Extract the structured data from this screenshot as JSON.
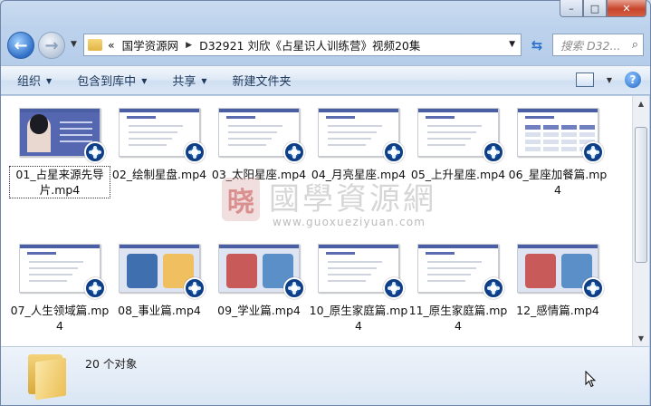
{
  "window": {
    "caption_buttons": [
      "–",
      "□",
      "✕"
    ]
  },
  "nav": {
    "breadcrumb_root": "«",
    "breadcrumbs": [
      "国学资源网",
      "D32921  刘欣《占星识人训练营》视频20集"
    ],
    "search_placeholder": "搜索 D32..."
  },
  "toolbar": {
    "items": [
      "组织",
      "包含到库中",
      "共享",
      "新建文件夹"
    ],
    "help_label": "?"
  },
  "files": [
    {
      "name": "01_占星来源先导片.mp4",
      "thumb": "portrait",
      "selected": true
    },
    {
      "name": "02_绘制星盘.mp4",
      "thumb": "doc"
    },
    {
      "name": "03_太阳星座.mp4",
      "thumb": "doc"
    },
    {
      "name": "04_月亮星座.mp4",
      "thumb": "doc"
    },
    {
      "name": "05_上升星座.mp4",
      "thumb": "doc"
    },
    {
      "name": "06_星座加餐篇.mp4",
      "thumb": "table"
    },
    {
      "name": "07_人生领域篇.mp4",
      "thumb": "doc"
    },
    {
      "name": "08_事业篇.mp4",
      "thumb": "scene"
    },
    {
      "name": "09_学业篇.mp4",
      "thumb": "scene"
    },
    {
      "name": "10_原生家庭篇.mp4",
      "thumb": "doc"
    },
    {
      "name": "11_原生家庭篇.mp4",
      "thumb": "doc"
    },
    {
      "name": "12_感情篇.mp4",
      "thumb": "scene"
    }
  ],
  "watermark": {
    "seal": "晓",
    "name": "國學資源網",
    "url": "www.guoxueziyuan.com"
  },
  "details": {
    "count": "20 个对象"
  },
  "colors": {
    "slide_accent": "#4a5ea3",
    "frame": "#bcd2ec"
  }
}
